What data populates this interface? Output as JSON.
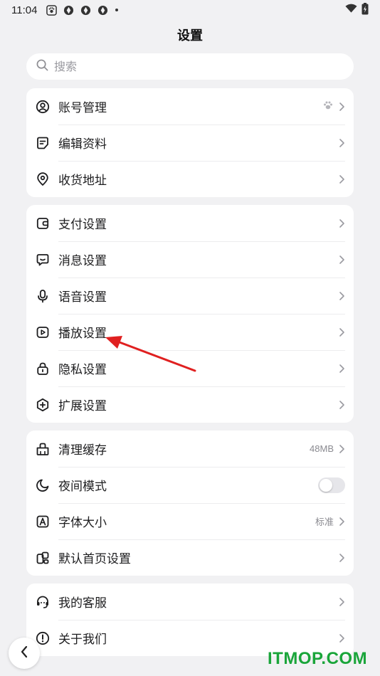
{
  "status_bar": {
    "time": "11:04"
  },
  "page": {
    "title": "设置"
  },
  "search": {
    "placeholder": "搜索"
  },
  "groups": [
    {
      "items": [
        {
          "label": "账号管理",
          "icon": "user-circle-icon",
          "trail": "paw-icon"
        },
        {
          "label": "编辑资料",
          "icon": "edit-note-icon"
        },
        {
          "label": "收货地址",
          "icon": "location-pin-icon"
        }
      ]
    },
    {
      "items": [
        {
          "label": "支付设置",
          "icon": "wallet-icon"
        },
        {
          "label": "消息设置",
          "icon": "chat-bubble-icon"
        },
        {
          "label": "语音设置",
          "icon": "microphone-icon"
        },
        {
          "label": "播放设置",
          "icon": "play-icon"
        },
        {
          "label": "隐私设置",
          "icon": "lock-icon"
        },
        {
          "label": "扩展设置",
          "icon": "plus-hexagon-icon"
        }
      ]
    },
    {
      "items": [
        {
          "label": "清理缓存",
          "icon": "broom-icon",
          "value": "48MB"
        },
        {
          "label": "夜间模式",
          "icon": "moon-icon",
          "toggle": false
        },
        {
          "label": "字体大小",
          "icon": "font-a-icon",
          "value": "标准"
        },
        {
          "label": "默认首页设置",
          "icon": "home-layout-icon"
        }
      ]
    },
    {
      "items": [
        {
          "label": "我的客服",
          "icon": "headset-icon"
        },
        {
          "label": "关于我们",
          "icon": "info-circle-icon"
        }
      ]
    }
  ],
  "watermark": {
    "text": "ITMOP.COM"
  },
  "colors": {
    "background": "#f1f1f3",
    "card": "#ffffff",
    "annotation_arrow": "#e02020",
    "watermark": "#1aa53a"
  }
}
